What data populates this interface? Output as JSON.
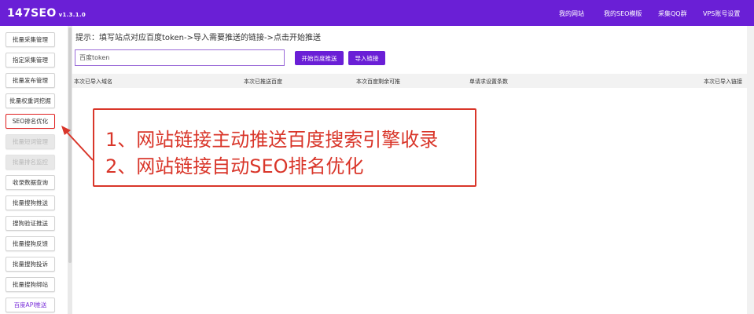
{
  "header": {
    "brand": "147SEO",
    "version": "v1.3.1.0",
    "nav": [
      "我的网站",
      "我的SEO模版",
      "采集QQ群",
      "VPS账号设置"
    ]
  },
  "sidebar": {
    "items": [
      {
        "label": "批量采集管理",
        "state": "normal"
      },
      {
        "label": "指定采集管理",
        "state": "normal"
      },
      {
        "label": "批量发布管理",
        "state": "normal"
      },
      {
        "label": "批量权重词挖掘",
        "state": "normal"
      },
      {
        "label": "SEO排名优化",
        "state": "active"
      },
      {
        "label": "批量短词管理",
        "state": "disabled"
      },
      {
        "label": "批量排名监控",
        "state": "disabled"
      },
      {
        "label": "收录数据查询",
        "state": "normal"
      },
      {
        "label": "批量搜狗推送",
        "state": "normal"
      },
      {
        "label": "搜狗验证推送",
        "state": "normal"
      },
      {
        "label": "批量搜狗反馈",
        "state": "normal"
      },
      {
        "label": "批量搜狗投诉",
        "state": "normal"
      },
      {
        "label": "批量搜狗绑站",
        "state": "normal"
      },
      {
        "label": "百度API推送",
        "state": "purple"
      }
    ]
  },
  "main": {
    "hint": "提示：填写站点对应百度token->导入需要推送的链接->点击开始推送",
    "token_value": "百度token",
    "token_placeholder": "百度token",
    "start_button": "开始百度推送",
    "import_button": "导入链接",
    "table_headers": [
      "本次已导入域名",
      "本次已推送百度",
      "本次百度剩余可推",
      "单请求设置条数",
      "本次已导入链接"
    ]
  },
  "annotation": {
    "lines": [
      "1、网站链接主动推送百度搜索引擎收录",
      "2、网站链接自动SEO排名优化"
    ],
    "color": "#d9362a"
  },
  "colors": {
    "accent": "#6a1fd6",
    "annotation_red": "#d9362a"
  }
}
